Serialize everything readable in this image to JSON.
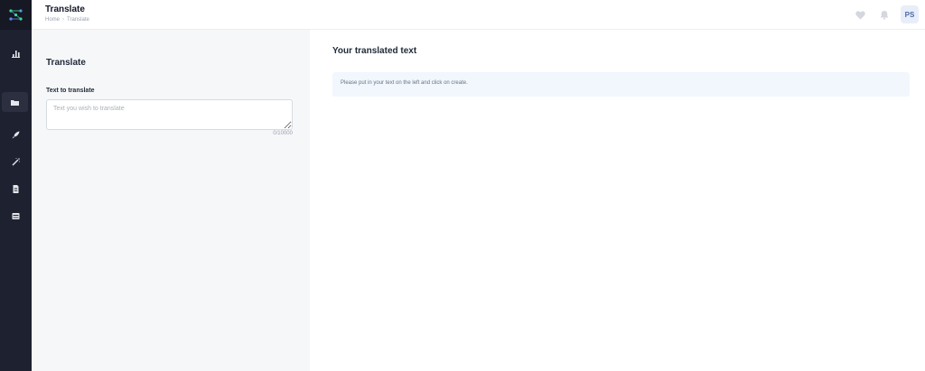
{
  "header": {
    "title": "Translate",
    "breadcrumb": [
      "Home",
      "Translate"
    ],
    "breadcrumb_separator": "›",
    "avatar_initials": "PS"
  },
  "sidebar": {
    "items": [
      {
        "icon": "chart-icon"
      },
      {
        "icon": "folder-icon",
        "active": true
      },
      {
        "icon": "rocket-icon"
      },
      {
        "icon": "magic-wand-icon"
      },
      {
        "icon": "document-icon"
      },
      {
        "icon": "window-icon"
      }
    ]
  },
  "left": {
    "title": "Translate",
    "field_label": "Text to translate",
    "input_placeholder": "Text you wish to translate",
    "input_value": "",
    "counter": "0/10000"
  },
  "right": {
    "title": "Your translated text",
    "message": "Please put in your text on the left and click on create."
  },
  "colors": {
    "sidebar": "#1e2130",
    "accent_green": "#3ddc97",
    "accent_blue": "#5b8def",
    "panel_bg": "#f6f7f9",
    "result_bg": "#f1f7fd"
  }
}
